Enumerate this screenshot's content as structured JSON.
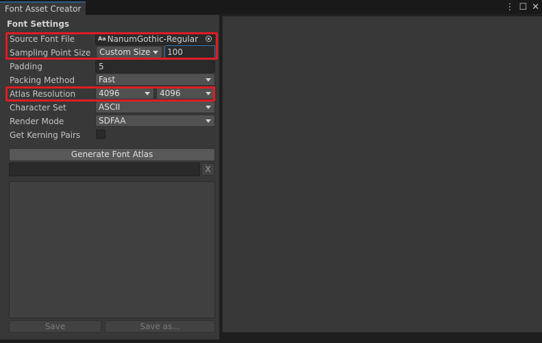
{
  "tab": {
    "title": "Font Asset Creator",
    "background_label": ""
  },
  "header_icons": {
    "menu": "⋮",
    "maximize": "☐",
    "close": "✕"
  },
  "section_title": "Font Settings",
  "fields": {
    "source_font_file": {
      "label": "Source Font File",
      "value": "NanumGothic-Regular",
      "glyph": "Aa"
    },
    "sampling_point_size": {
      "label": "Sampling Point Size",
      "mode": "Custom Size",
      "value": "100"
    },
    "padding": {
      "label": "Padding",
      "value": "5"
    },
    "packing_method": {
      "label": "Packing Method",
      "value": "Fast"
    },
    "atlas_resolution": {
      "label": "Atlas Resolution",
      "width": "4096",
      "height": "4096"
    },
    "character_set": {
      "label": "Character Set",
      "value": "ASCII"
    },
    "render_mode": {
      "label": "Render Mode",
      "value": "SDFAA"
    },
    "kerning_pairs": {
      "label": "Get Kerning Pairs",
      "checked": false
    }
  },
  "generate_button": "Generate Font Atlas",
  "clear_button": "X",
  "save_button": "Save",
  "save_as_button": "Save as...",
  "colors": {
    "highlight": "#e01c24",
    "panel": "#383838",
    "accent": "#3a79bb"
  }
}
